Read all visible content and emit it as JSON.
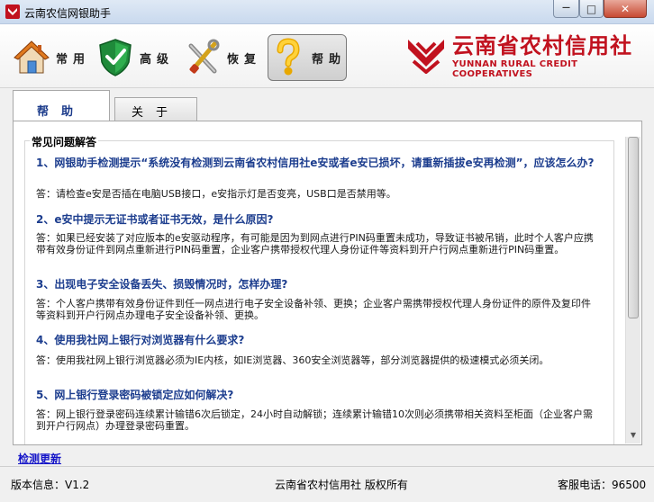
{
  "window": {
    "title": "云南农信网银助手",
    "minimize_symbol": "—",
    "maximize_symbol": "□",
    "close_symbol": "✕"
  },
  "toolbar": {
    "buttons": [
      {
        "label": "常用",
        "icon": "house-icon",
        "active": false
      },
      {
        "label": "高级",
        "icon": "shield-check-icon",
        "active": false
      },
      {
        "label": "恢复",
        "icon": "tools-icon",
        "active": false
      },
      {
        "label": "帮助",
        "icon": "question-icon",
        "active": true
      }
    ]
  },
  "brand": {
    "name_cn": "云南省农村信用社",
    "name_en": "YUNNAN RURAL CREDIT COOPERATIVES",
    "color": "#c1121f"
  },
  "tabs": [
    {
      "label": "帮助",
      "active": true
    },
    {
      "label": "关于",
      "active": false
    }
  ],
  "faq": {
    "title": "常见问题解答",
    "items": [
      {
        "q": "1、网银助手检测提示“系统没有检测到云南省农村信用社e安或者e安已损坏，请重新插拔e安再检测”，应该怎么办?",
        "a": "答：请检查e安是否插在电脑USB接口，e安指示灯是否变亮，USB口是否禁用等。"
      },
      {
        "q": "2、e安中提示无证书或者证书无效，是什么原因?",
        "a": "答：如果已经安装了对应版本的e安驱动程序，有可能是因为到网点进行PIN码重置未成功，导致证书被吊销，此时个人客户应携带有效身份证件到网点重新进行PIN码重置，企业客户携带授权代理人身份证件等资料到开户行网点重新进行PIN码重置。"
      },
      {
        "q": "3、出现电子安全设备丢失、损毁情况时，怎样办理?",
        "a": "答：个人客户携带有效身份证件到任一网点进行电子安全设备补领、更换；企业客户需携带授权代理人身份证件的原件及复印件等资料到开户行网点办理电子安全设备补领、更换。"
      },
      {
        "q": "4、使用我社网上银行对浏览器有什么要求?",
        "a": "答：使用我社网上银行浏览器必须为IE内核，如IE浏览器、360安全浏览器等，部分浏览器提供的极速模式必须关闭。"
      },
      {
        "q": "5、网上银行登录密码被锁定应如何解决?",
        "a": "答：网上银行登录密码连续累计输错6次后锁定，24小时自动解锁；连续累计输错10次则必须携带相关资料至柜面（企业客户需到开户行网点）办理登录密码重置。"
      }
    ]
  },
  "links": {
    "check_update": "检测更新"
  },
  "status": {
    "version": "版本信息：V1.2",
    "copyright": "云南省农村信用社  版权所有",
    "hotline": "客服电话：96500"
  }
}
